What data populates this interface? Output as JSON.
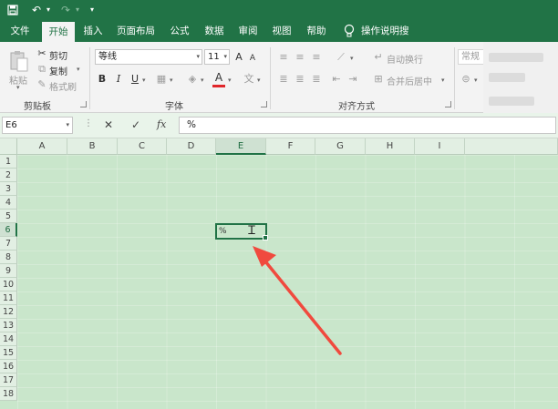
{
  "quick_access": {
    "save_icon": "save-icon",
    "undo_icon": "undo-icon",
    "redo_icon": "redo-icon",
    "more": "▾"
  },
  "tabs": [
    {
      "label": "文件",
      "active": false
    },
    {
      "label": "开始",
      "active": true
    },
    {
      "label": "插入",
      "active": false
    },
    {
      "label": "页面布局",
      "active": false
    },
    {
      "label": "公式",
      "active": false
    },
    {
      "label": "数据",
      "active": false
    },
    {
      "label": "审阅",
      "active": false
    },
    {
      "label": "视图",
      "active": false
    },
    {
      "label": "帮助",
      "active": false
    }
  ],
  "tell_me": "操作说明搜索",
  "clipboard": {
    "paste": "粘贴",
    "cut": "剪切",
    "copy": "复制",
    "format_painter": "格式刷",
    "group_label": "剪贴板"
  },
  "font": {
    "name": "等线",
    "size": "11",
    "group_label": "字体",
    "bold": "B",
    "italic": "I",
    "underline": "U",
    "font_color_letter": "A",
    "grow": "A",
    "shrink": "A"
  },
  "alignment": {
    "wrap_text": "自动换行",
    "merge_center": "合并后居中",
    "group_label": "对齐方式"
  },
  "number": {
    "format": "常规"
  },
  "formula_bar": {
    "cell_ref": "E6",
    "cancel": "✕",
    "enter": "✓",
    "fx": "fx",
    "content": "%"
  },
  "columns": [
    "A",
    "B",
    "C",
    "D",
    "E",
    "F",
    "G",
    "H",
    "I"
  ],
  "selected_column": "E",
  "rows": [
    "1",
    "2",
    "3",
    "4",
    "5",
    "6",
    "7",
    "8",
    "9",
    "10",
    "11",
    "12",
    "13",
    "14",
    "15",
    "16",
    "17",
    "18"
  ],
  "selected_row": "6",
  "active_cell": {
    "ref": "E6",
    "value": "%"
  },
  "colors": {
    "excel_green": "#217346",
    "sheet_bg": "#c9e6cb",
    "arrow_red": "#f04a3e"
  }
}
